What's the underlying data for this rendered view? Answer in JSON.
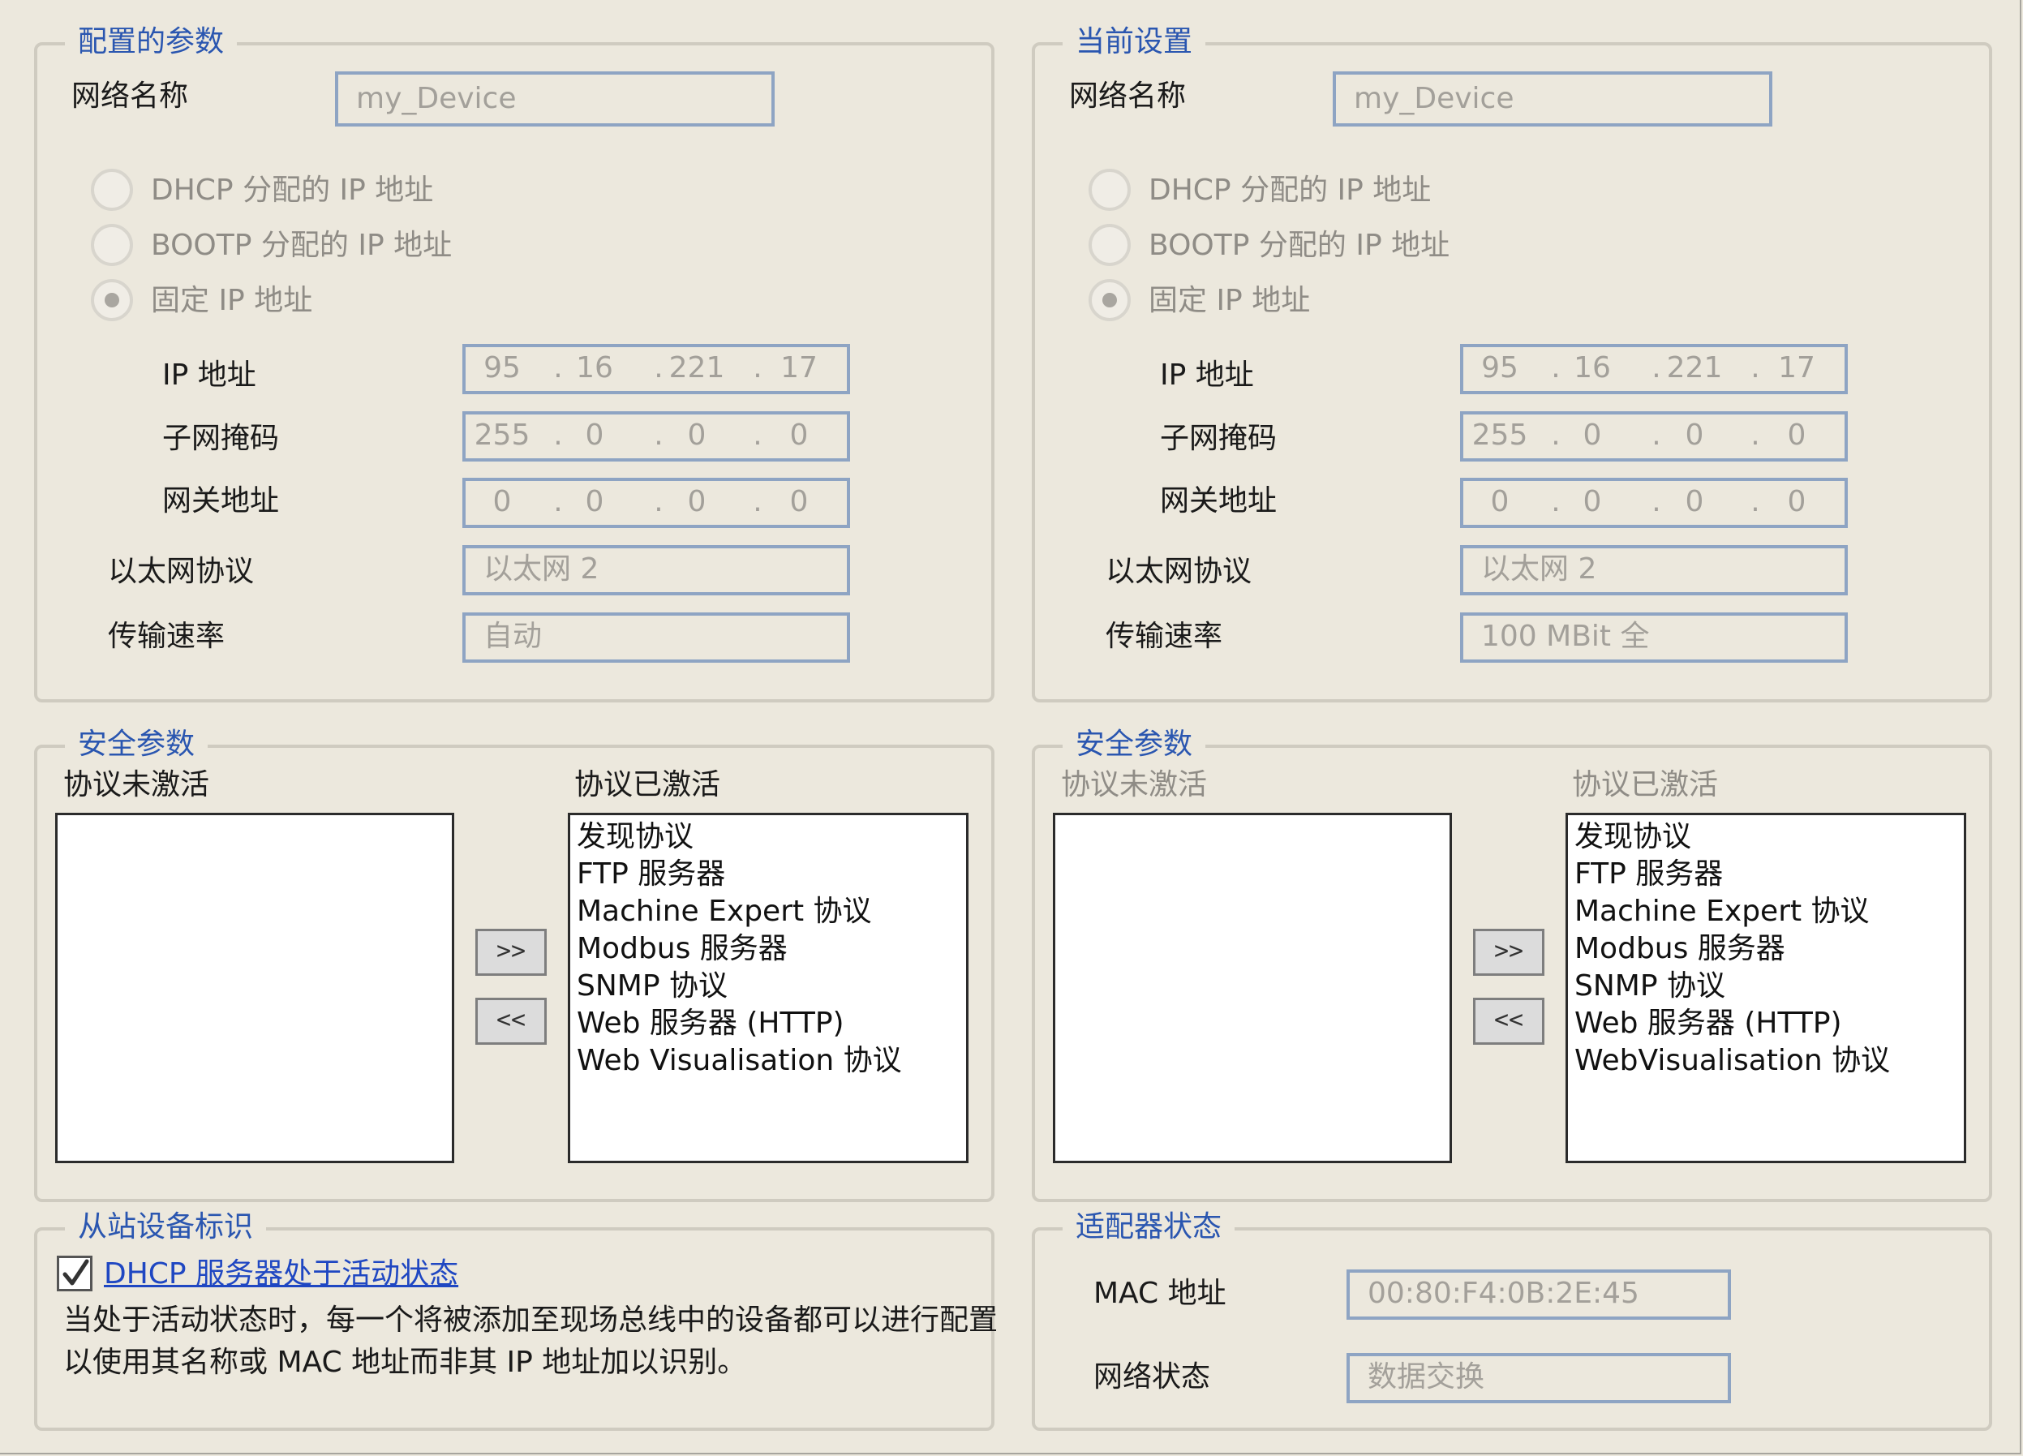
{
  "configured": {
    "legend": "配置的参数",
    "network_name_label": "网络名称",
    "network_name_value": "my_Device",
    "radio_dhcp": "DHCP 分配的 IP 地址",
    "radio_bootp": "BOOTP 分配的 IP 地址",
    "radio_fixed": "固定 IP 地址",
    "ip_label": "IP 地址",
    "ip": [
      "95",
      "16",
      "221",
      "17"
    ],
    "subnet_label": "子网掩码",
    "subnet": [
      "255",
      "0",
      "0",
      "0"
    ],
    "gateway_label": "网关地址",
    "gateway": [
      "0",
      "0",
      "0",
      "0"
    ],
    "ethernet_label": "以太网协议",
    "ethernet_value": "以太网 2",
    "speed_label": "传输速率",
    "speed_value": "自动"
  },
  "current": {
    "legend": "当前设置",
    "network_name_label": "网络名称",
    "network_name_value": "my_Device",
    "radio_dhcp": "DHCP 分配的 IP 地址",
    "radio_bootp": "BOOTP 分配的 IP 地址",
    "radio_fixed": "固定 IP 地址",
    "ip_label": "IP 地址",
    "ip": [
      "95",
      "16",
      "221",
      "17"
    ],
    "subnet_label": "子网掩码",
    "subnet": [
      "255",
      "0",
      "0",
      "0"
    ],
    "gateway_label": "网关地址",
    "gateway": [
      "0",
      "0",
      "0",
      "0"
    ],
    "ethernet_label": "以太网协议",
    "ethernet_value": "以太网 2",
    "speed_label": "传输速率",
    "speed_value": "100 MBit 全"
  },
  "security_left": {
    "legend": "安全参数",
    "inactive_label": "协议未激活",
    "active_label": "协议已激活",
    "add_button": ">>",
    "remove_button": "<<",
    "active_items": [
      "发现协议",
      "FTP 服务器",
      "Machine Expert 协议",
      "Modbus 服务器",
      "SNMP 协议",
      "Web 服务器 (HTTP)",
      "Web Visualisation 协议"
    ]
  },
  "security_right": {
    "legend": "安全参数",
    "inactive_label": "协议未激活",
    "active_label": "协议已激活",
    "add_button": ">>",
    "remove_button": "<<",
    "active_items": [
      "发现协议",
      "FTP 服务器",
      "Machine Expert 协议",
      "Modbus 服务器",
      "SNMP 协议",
      "Web 服务器 (HTTP)",
      "WebVisualisation 协议"
    ]
  },
  "slave": {
    "legend": "从站设备标识",
    "checkbox_checked": true,
    "checkbox_label": "DHCP 服务器处于活动状态",
    "description": "当处于活动状态时，每一个将被添加至现场总线中的设备都可以进行配置以使用其名称或 MAC 地址而非其 IP 地址加以识别。"
  },
  "adapter": {
    "legend": "适配器状态",
    "mac_label": "MAC 地址",
    "mac_value": "00:80:F4:0B:2E:45",
    "net_status_label": "网络状态",
    "net_status_value": "数据交换"
  },
  "colors": {
    "background": "#ece8dd",
    "legend_text": "#2a56b0",
    "field_border": "#8ea4c3",
    "link": "#1f47c2"
  }
}
